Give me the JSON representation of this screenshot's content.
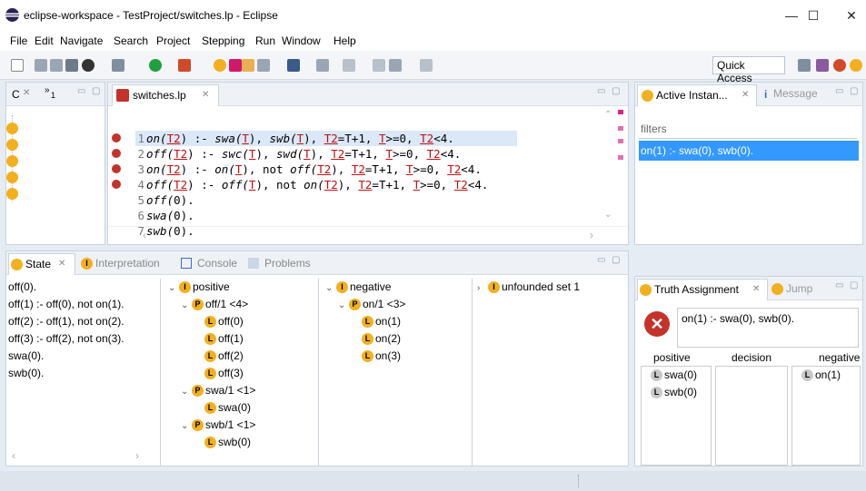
{
  "window": {
    "title": "eclipse-workspace - TestProject/switches.lp - Eclipse",
    "minimize": "—",
    "maximize": "☐",
    "close": "✕"
  },
  "menu": [
    "File",
    "Edit",
    "Navigate",
    "Search",
    "Project",
    "Stepping",
    "Run",
    "Window",
    "Help"
  ],
  "toolbar": {
    "quick_access": "Quick Access"
  },
  "left_view": {
    "tab": "C",
    "tab_extra": "»",
    "tab_count": "1"
  },
  "editor": {
    "tab": "switches.lp",
    "lines": [
      {
        "n": "1",
        "parts": [
          [
            "on(",
            "it"
          ],
          [
            "T2",
            "red"
          ],
          [
            ") :- ",
            ""
          ],
          [
            "swa(",
            "it"
          ],
          [
            "T",
            "red"
          ],
          [
            ")",
            ""
          ],
          [
            ", ",
            ""
          ],
          [
            "swb(",
            "it"
          ],
          [
            "T",
            "red"
          ],
          [
            "), ",
            ""
          ],
          [
            "T2",
            "red"
          ],
          [
            "=T+1, ",
            ""
          ],
          [
            "T",
            "red"
          ],
          [
            ">=0, ",
            ""
          ],
          [
            "T2",
            "red"
          ],
          [
            "<4.",
            ""
          ]
        ],
        "error": true
      },
      {
        "n": "2",
        "parts": [
          [
            "off(",
            "it"
          ],
          [
            "T2",
            "red"
          ],
          [
            ") :- ",
            ""
          ],
          [
            "swc(",
            "it"
          ],
          [
            "T",
            "red"
          ],
          [
            "), ",
            ""
          ],
          [
            "swd(",
            "it"
          ],
          [
            "T",
            "red"
          ],
          [
            "), ",
            ""
          ],
          [
            "T2",
            "red"
          ],
          [
            "=T+1, ",
            ""
          ],
          [
            "T",
            "red"
          ],
          [
            ">=0, ",
            ""
          ],
          [
            "T2",
            "red"
          ],
          [
            "<4.",
            ""
          ]
        ],
        "error": true
      },
      {
        "n": "3",
        "parts": [
          [
            "on(",
            "it"
          ],
          [
            "T2",
            "red"
          ],
          [
            ") :- ",
            ""
          ],
          [
            "on(",
            "it"
          ],
          [
            "T",
            "red"
          ],
          [
            "), not ",
            ""
          ],
          [
            "off(",
            "it"
          ],
          [
            "T2",
            "red"
          ],
          [
            "), ",
            ""
          ],
          [
            "T2",
            "red"
          ],
          [
            "=T+1, ",
            ""
          ],
          [
            "T",
            "red"
          ],
          [
            ">=0, ",
            ""
          ],
          [
            "T2",
            "red"
          ],
          [
            "<4.",
            ""
          ]
        ],
        "error": true
      },
      {
        "n": "4",
        "parts": [
          [
            "off(",
            "it"
          ],
          [
            "T2",
            "red"
          ],
          [
            ") :- ",
            ""
          ],
          [
            "off(",
            "it"
          ],
          [
            "T",
            "red"
          ],
          [
            "), not ",
            ""
          ],
          [
            "on(",
            "it"
          ],
          [
            "T2",
            "red"
          ],
          [
            "), ",
            ""
          ],
          [
            "T2",
            "red"
          ],
          [
            "=T+1, ",
            ""
          ],
          [
            "T",
            "red"
          ],
          [
            ">=0, ",
            ""
          ],
          [
            "T2",
            "red"
          ],
          [
            "<4.",
            ""
          ]
        ],
        "error": true
      },
      {
        "n": "5",
        "parts": [
          [
            "off(",
            "it"
          ],
          [
            "0",
            ""
          ],
          [
            ").",
            ""
          ]
        ],
        "error": false
      },
      {
        "n": "6",
        "parts": [
          [
            "swa(",
            "it"
          ],
          [
            "0",
            ""
          ],
          [
            ").",
            ""
          ]
        ],
        "error": false
      },
      {
        "n": "7",
        "parts": [
          [
            "swb(",
            "it"
          ],
          [
            "0",
            ""
          ],
          [
            ").",
            ""
          ]
        ],
        "error": false
      }
    ]
  },
  "active_instances": {
    "tab": "Active Instan...",
    "tab2": "Message",
    "filter_placeholder": "filters",
    "selected": "on(1) :- swa(0), swb(0)."
  },
  "bottom_tabs": {
    "state": "State",
    "interpretation": "Interpretation",
    "console": "Console",
    "problems": "Problems"
  },
  "state_list": [
    "off(0).",
    "off(1) :- off(0), not on(1).",
    "off(2) :- off(1), not on(2).",
    "off(3) :- off(2), not on(3).",
    "swa(0).",
    "swb(0)."
  ],
  "positive": {
    "label": "positive",
    "groups": [
      {
        "label": "off/1 <4>",
        "items": [
          "off(0)",
          "off(1)",
          "off(2)",
          "off(3)"
        ]
      },
      {
        "label": "swa/1 <1>",
        "items": [
          "swa(0)"
        ]
      },
      {
        "label": "swb/1 <1>",
        "items": [
          "swb(0)"
        ]
      }
    ]
  },
  "negative": {
    "label": "negative",
    "groups": [
      {
        "label": "on/1 <3>",
        "items": [
          "on(1)",
          "on(2)",
          "on(3)"
        ]
      }
    ]
  },
  "unfounded": {
    "label": "unfounded set 1"
  },
  "truth": {
    "tab": "Truth Assignment",
    "tab2": "Jump",
    "rule": "on(1) :- swa(0), swb(0).",
    "cols": {
      "positive": "positive",
      "decision": "decision",
      "negative": "negative"
    },
    "positive_items": [
      "swa(0)",
      "swb(0)"
    ],
    "negative_items": [
      "on(1)"
    ]
  },
  "colors": {
    "selection": "#3399ff",
    "error": "#c4322a",
    "badge": "#f2b01e"
  }
}
